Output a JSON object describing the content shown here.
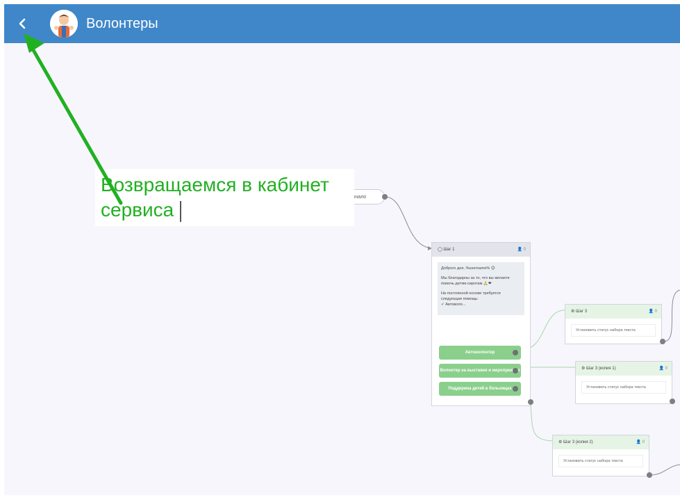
{
  "header": {
    "title": "Волонтеры",
    "back_icon": "chevron-left-icon",
    "avatar_icon": "volunteer-avatar-icon",
    "color": "#3f87c9"
  },
  "flow": {
    "start_label": "Начало",
    "step1": {
      "title": "Шаг 1",
      "counter": "0",
      "message": {
        "greeting": "Доброго дня, %username% 😊",
        "line2": "Мы благодарны за то, что вы желаете помочь детям-сиротам 🙏❤",
        "line3": "На постоянной основе требуется следующая помощь:",
        "line4": "✓ Автоволо..."
      },
      "buttons": [
        "Автоволонтер",
        "Волонтер на выставки и мероприятия",
        "Поддержка детей в больницах"
      ]
    },
    "actions": [
      {
        "title": "Шаг 3",
        "counter": "0",
        "body": "Установить статус набора текста"
      },
      {
        "title": "Шаг 3 (копия 1)",
        "counter": "0",
        "body": "Установить статус набора текста"
      },
      {
        "title": "Шаг 3 (копия 2)",
        "counter": "0",
        "body": "Установить статус набора текста"
      }
    ]
  },
  "annotation": {
    "line1": "Возвращаемся в кабинет",
    "line2": "сервиса",
    "color": "#22b022"
  }
}
